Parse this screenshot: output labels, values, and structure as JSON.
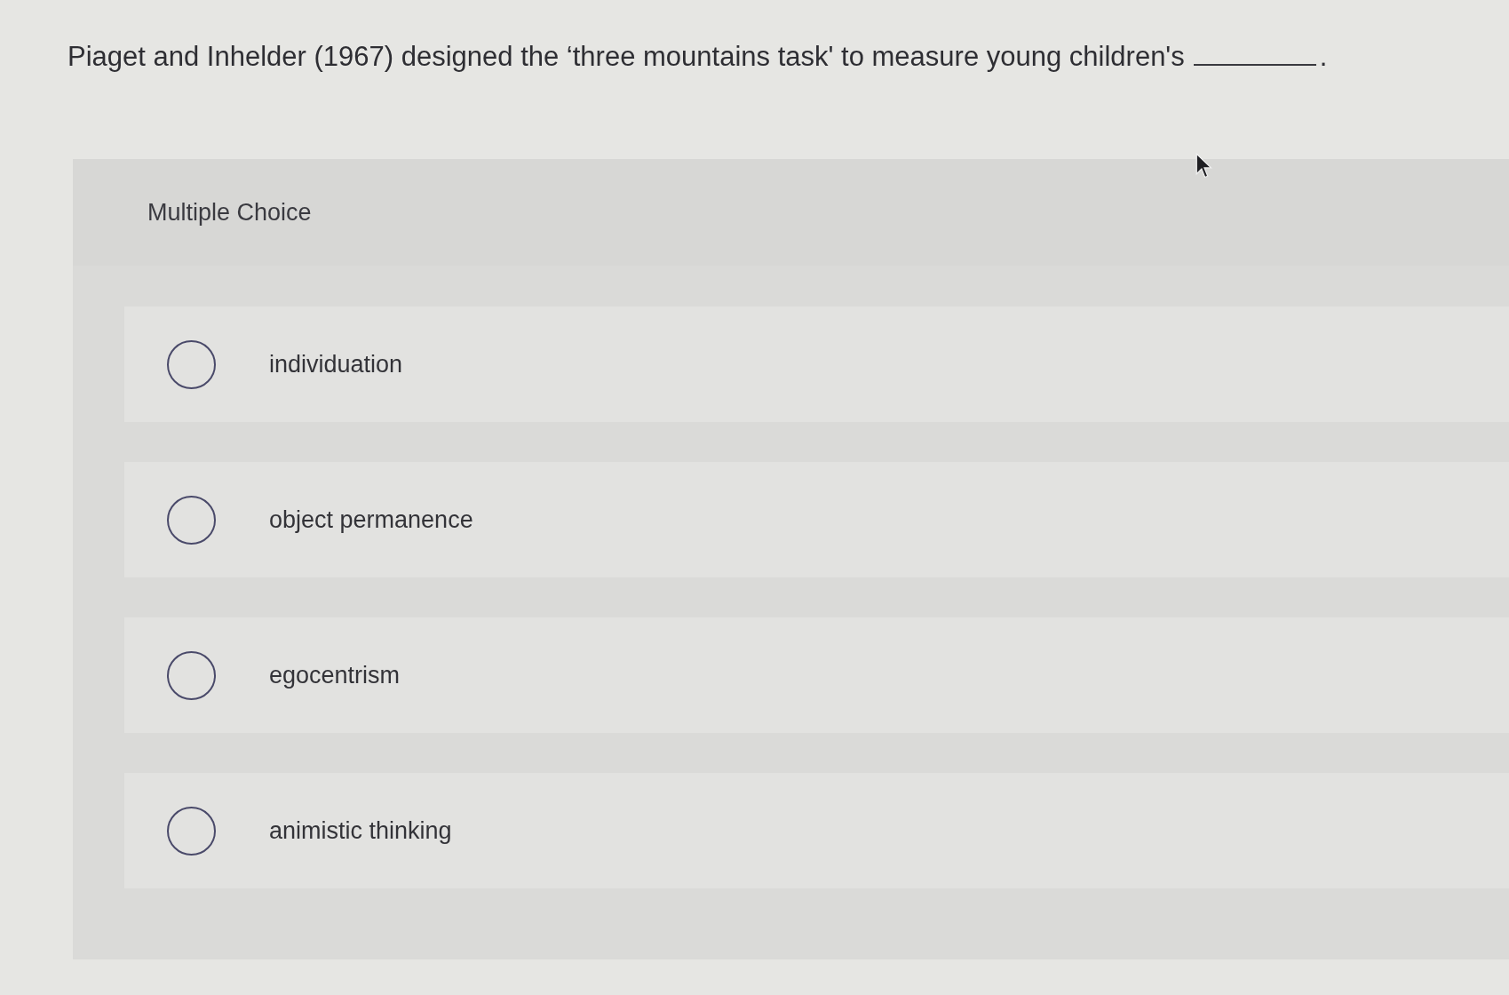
{
  "question": {
    "text": "Piaget and Inhelder (1967) designed the ‘three mountains task' to measure young children's",
    "after_blank": "."
  },
  "panel": {
    "title": "Multiple Choice"
  },
  "options": [
    {
      "label": "individuation",
      "selected": false
    },
    {
      "label": "object permanence",
      "selected": false
    },
    {
      "label": "egocentrism",
      "selected": false
    },
    {
      "label": "animistic thinking",
      "selected": false
    }
  ]
}
